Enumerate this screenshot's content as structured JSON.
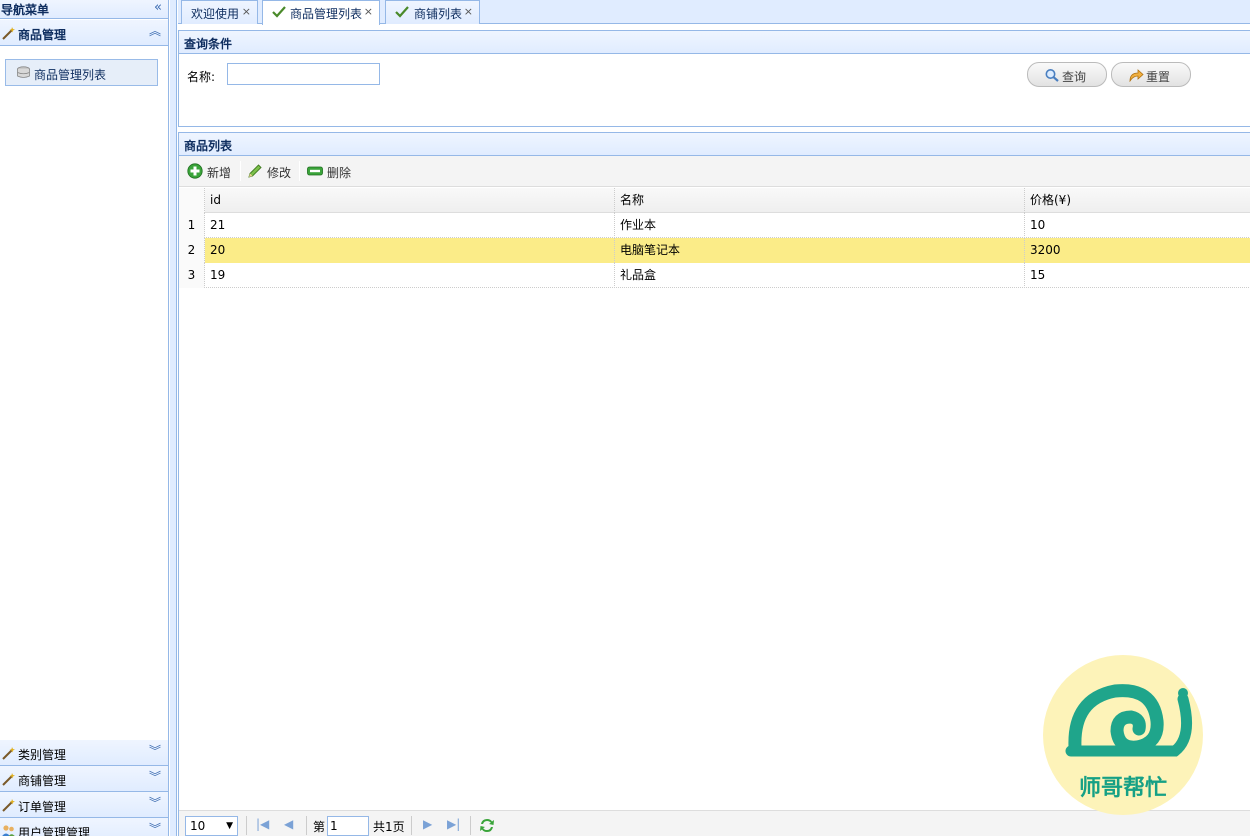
{
  "nav": {
    "title": "导航菜单",
    "sections": [
      {
        "label": "商品管理",
        "expanded": true,
        "items": [
          {
            "label": "商品管理列表"
          }
        ]
      },
      {
        "label": "类别管理"
      },
      {
        "label": "商铺管理"
      },
      {
        "label": "订单管理"
      },
      {
        "label": "用户管理管理"
      }
    ]
  },
  "tabs": [
    {
      "label": "欢迎使用",
      "active": false
    },
    {
      "label": "商品管理列表",
      "active": true
    },
    {
      "label": "商铺列表",
      "active": false
    }
  ],
  "query": {
    "title": "查询条件",
    "name_label": "名称:",
    "name_value": "",
    "search_label": "查询",
    "reset_label": "重置"
  },
  "grid": {
    "title": "商品列表",
    "toolbar": {
      "add": "新增",
      "edit": "修改",
      "delete": "删除"
    },
    "columns": [
      "id",
      "名称",
      "价格(¥)"
    ],
    "rows": [
      {
        "num": "1",
        "id": "21",
        "name": "作业本",
        "price": "10"
      },
      {
        "num": "2",
        "id": "20",
        "name": "电脑笔记本",
        "price": "3200"
      },
      {
        "num": "3",
        "id": "19",
        "name": "礼品盒",
        "price": "15"
      }
    ],
    "selected_row": 2
  },
  "pager": {
    "page_size": "10",
    "page_prefix": "第",
    "page_current": "1",
    "page_total": "共1页"
  },
  "watermark": {
    "text": "师哥帮忙"
  },
  "colors": {
    "panel_border": "#95b8e7",
    "header_bg": "#e0ecff",
    "selected_row": "#fbec88",
    "logo_green": "#1fa58b",
    "logo_bg": "#fdf3b9",
    "logo_text": "#16a085"
  }
}
